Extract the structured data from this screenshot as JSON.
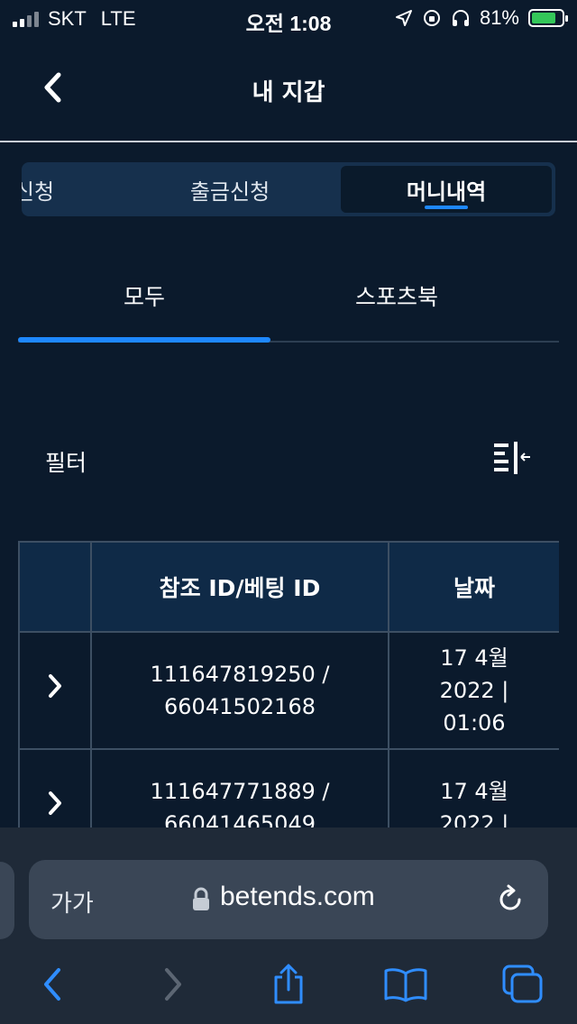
{
  "status_bar": {
    "carrier": "SKT",
    "network": "LTE",
    "time": "오전 1:08",
    "battery_percent": "81%",
    "battery_level": 0.81
  },
  "header": {
    "title": "내 지갑"
  },
  "segment_tabs": [
    {
      "label": "신청"
    },
    {
      "label": "출금신청"
    },
    {
      "label": "머니내역",
      "active": true
    }
  ],
  "sub_tabs": [
    {
      "label": "모두",
      "active": true
    },
    {
      "label": "스포츠북"
    }
  ],
  "filter": {
    "label": "필터"
  },
  "table": {
    "headers": [
      "",
      "참조 ID/베팅 ID",
      "날짜"
    ],
    "rows": [
      {
        "ref_line1": "111647819250 /",
        "ref_line2": "66041502168",
        "date_line1": "17 4월",
        "date_line2": "2022 |",
        "date_line3": "01:06"
      },
      {
        "ref_line1": "111647771889 /",
        "ref_line2": "66041465049",
        "date_line1": "17 4월",
        "date_line2": "2022 |",
        "date_line3": ""
      }
    ]
  },
  "browser": {
    "text_size_label": "가가",
    "url": "betends.com"
  },
  "colors": {
    "background": "#0b1a2c",
    "accent": "#1e88ff",
    "table_header": "#0f2a47",
    "browser_bar": "#1f2a38"
  }
}
